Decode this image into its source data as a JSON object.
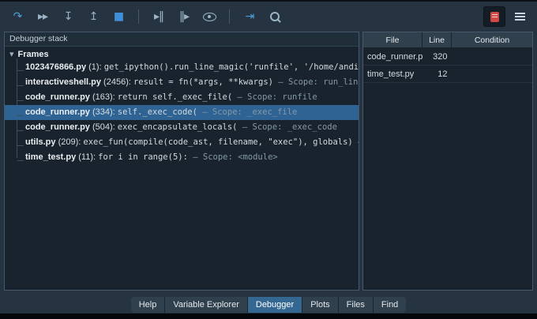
{
  "toolbar": {
    "left_icons": [
      {
        "name": "continue-icon",
        "glyph": "↷",
        "color": "#4fa0d8"
      },
      {
        "name": "step-over-icon",
        "glyph": "▸▸",
        "color": "#9ab4c6"
      },
      {
        "name": "step-into-icon",
        "glyph": "↧",
        "color": "#9ab4c6"
      },
      {
        "name": "step-return-icon",
        "glyph": "↥",
        "color": "#9ab4c6"
      },
      {
        "name": "stop-icon",
        "glyph": "■",
        "color": "#3f8fd8"
      },
      {
        "name": "toolbar-separator",
        "separator": true
      },
      {
        "name": "run-to-line-icon",
        "glyph": "▸‖",
        "color": "#9ab4c6"
      },
      {
        "name": "run-from-line-icon",
        "glyph": "‖▸",
        "color": "#9ab4c6"
      },
      {
        "name": "eye-icon",
        "shape": "eye"
      },
      {
        "name": "toolbar-separator",
        "separator": true
      },
      {
        "name": "exit-debugger-icon",
        "glyph": "⇥",
        "color": "#4fa0d8"
      },
      {
        "name": "search-icon",
        "shape": "search"
      }
    ],
    "right_icons": [
      {
        "name": "debug-file-icon",
        "shape": "debugfile",
        "active": true
      },
      {
        "name": "hamburger-menu-icon",
        "shape": "menu"
      }
    ]
  },
  "left_panel": {
    "title": "Debugger stack",
    "chevron": "▾",
    "frames_label": "Frames",
    "frames": [
      {
        "file": "1023476866.py",
        "line": "(1):",
        "code": "get_ipython().run_line_magic('runfile', '/home/andi/Dev/Spyde",
        "scope": ""
      },
      {
        "file": "interactiveshell.py",
        "line": "(2456):",
        "code": "result = fn(*args, **kwargs)",
        "scope": "— Scope: run_line_magic"
      },
      {
        "file": "code_runner.py",
        "line": "(163):",
        "code": "return self._exec_file(",
        "scope": "— Scope: runfile"
      },
      {
        "file": "code_runner.py",
        "line": "(334):",
        "code": "self._exec_code(",
        "scope": "— Scope: _exec_file",
        "selected": true
      },
      {
        "file": "code_runner.py",
        "line": "(504):",
        "code": "exec_encapsulate_locals(",
        "scope": "— Scope: _exec_code"
      },
      {
        "file": "utils.py",
        "line": "(209):",
        "code": "exec_fun(compile(code_ast, filename, \"exec\"), globals)",
        "scope": "— Scope: exec_en"
      },
      {
        "file": "time_test.py",
        "line": "(11):",
        "code": "for i in range(5):",
        "scope": "— Scope: <module>"
      }
    ]
  },
  "breakpoints": {
    "columns": [
      "File",
      "Line",
      "Condition"
    ],
    "rows": [
      {
        "file": "code_runner.py",
        "line": "320",
        "condition": ""
      },
      {
        "file": "time_test.py",
        "line": "12",
        "condition": ""
      }
    ]
  },
  "tabs": [
    {
      "label": "Help"
    },
    {
      "label": "Variable Explorer"
    },
    {
      "label": "Debugger",
      "active": true
    },
    {
      "label": "Plots"
    },
    {
      "label": "Files"
    },
    {
      "label": "Find"
    }
  ],
  "colors": {
    "accent": "#346792",
    "selection": "#2f6394",
    "breakpoint_red": "#cf4942"
  }
}
